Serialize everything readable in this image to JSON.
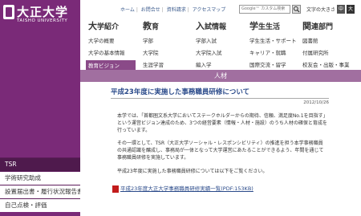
{
  "logo": {
    "name_ja": "大正大学",
    "name_en": "TAISHO UNIVERSITY"
  },
  "utility": {
    "links": [
      "ホーム",
      "お問合せ",
      "資料請求",
      "アクセスマップ"
    ],
    "search_placeholder": "Google™ カスタム検索",
    "font_size_label": "文字の大きさ",
    "font_size_medium": "中",
    "font_size_large": "大"
  },
  "nav": {
    "columns": [
      {
        "head_big": "大",
        "head_rest": "学紹介",
        "items": [
          "大学の概要",
          "大学の基本情報",
          "教育ビジョン"
        ]
      },
      {
        "head_big": "教",
        "head_rest": "育",
        "items": [
          "学部",
          "大学院",
          "生涯学習"
        ]
      },
      {
        "head_big": "入",
        "head_rest": "試情報",
        "items": [
          "学部入試",
          "大学院入試",
          "編入学"
        ]
      },
      {
        "head_big": "学",
        "head_rest": "生生活",
        "items": [
          "学生生活・サポート",
          "キャリア・就職",
          "国際交流・留学"
        ]
      },
      {
        "head_big": "関",
        "head_rest": "連部門",
        "items": [
          "図書館",
          "付属研究所",
          "校友会・出版・事業"
        ]
      }
    ],
    "selected": "教育ビジョン"
  },
  "band": {
    "title": "人材"
  },
  "article": {
    "title": "平成23年度に実施した事務職員研修について",
    "date": "2012/10/26",
    "paragraph1": "本学では、「首都圏文系大学においてステークホルダーからの期待、信頼、満足度No.1を目指す」という運営ビジョン達成のため、3つの経営要素（情報・人材・施設）のうち人材の確保と育成を行っています。",
    "paragraph2": "その一環として、TSR（大正大学ソーシャル・レスポンシビリティ）の推進を担う本学事務職員の共通認識を醸成し、事務局が一体となって大学運営にあたることができるよう、年間を通じて事務職員研修を実施しています。",
    "paragraph3": "平成23年度に実施した事務職員研修については以下をご覧ください。",
    "pdf_link": "平成23年度大正大学事務職員研修実績一覧(PDF:153KB)"
  },
  "sidebar": {
    "items": [
      {
        "label": "TSR",
        "active": true
      },
      {
        "label": "学術研究助成",
        "active": false
      },
      {
        "label": "設置届出書・履行状況報告書",
        "active": false
      },
      {
        "label": "自己点検・評価",
        "active": false
      }
    ]
  },
  "colors": {
    "brand": "#7a2a78",
    "band": "#a16fa0",
    "link": "#2a4a8a"
  }
}
